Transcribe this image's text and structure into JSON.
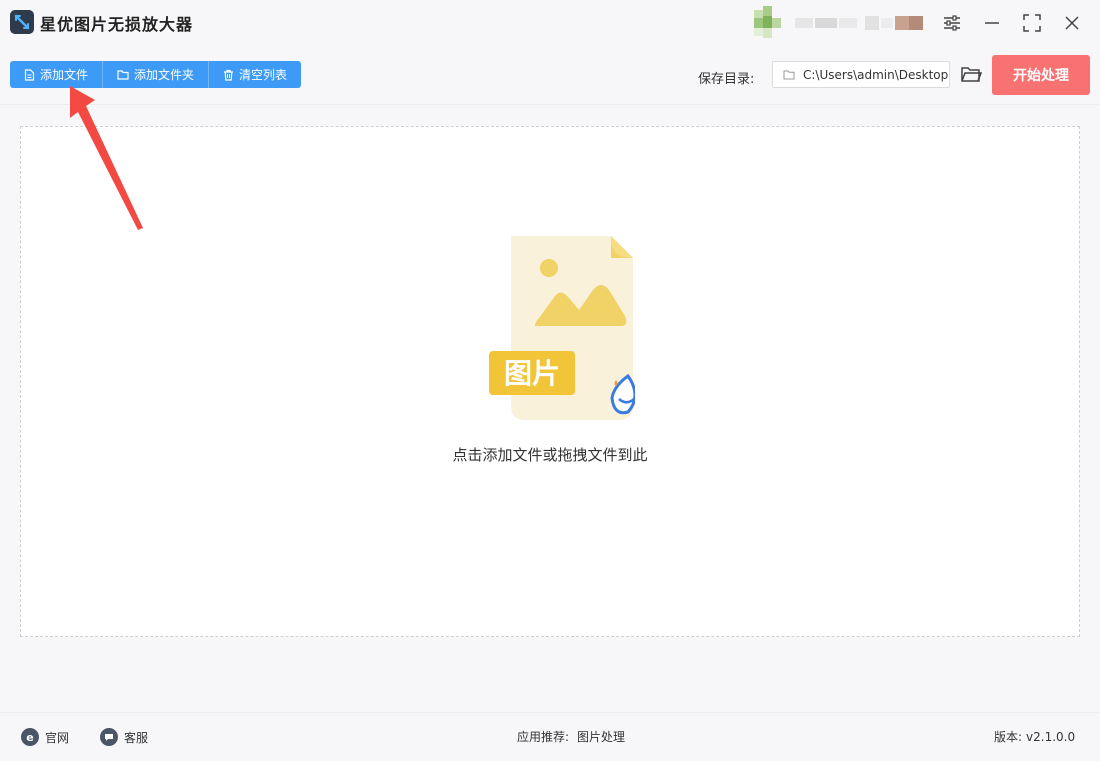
{
  "app": {
    "title": "星优图片无损放大器"
  },
  "toolbar": {
    "add_file": "添加文件",
    "add_folder": "添加文件夹",
    "clear_list": "清空列表",
    "save_dir_label": "保存目录:",
    "save_dir_value": "C:\\Users\\admin\\Desktop",
    "start": "开始处理"
  },
  "drop_zone": {
    "badge_text": "图片",
    "hint": "点击添加文件或拖拽文件到此"
  },
  "footer": {
    "website": "官网",
    "support": "客服",
    "recommend_label": "应用推荐:",
    "recommend_app": "图片处理",
    "version_label": "版本:",
    "version_value": "v2.1.0.0"
  },
  "colors": {
    "primary_button": "#3d9bf7",
    "start_button": "#f77271",
    "icon_yellow": "#f0d267",
    "icon_bg": "#faf1da",
    "arrow": "#f24a43"
  }
}
